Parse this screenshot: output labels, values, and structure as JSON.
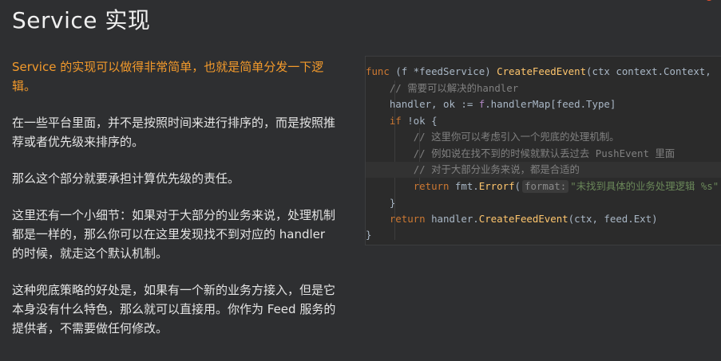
{
  "slide": {
    "title": "Service 实现",
    "logo_text": ""
  },
  "paragraphs": [
    {
      "text": "Service 的实现可以做得非常简单，也就是简单分发一下逻辑。",
      "highlight": true
    },
    {
      "text": "在一些平台里面，并不是按照时间来进行排序的，而是按照推荐或者优先级来排序的。",
      "highlight": false
    },
    {
      "text": "那么这个部分就要承担计算优先级的责任。",
      "highlight": false
    },
    {
      "text": "这里还有一个小细节：如果对于大部分的业务来说，处理机制都是一样的，那么你可以在这里发现找不到对应的 handler 的时候，就走这个默认机制。",
      "highlight": false
    },
    {
      "text": "这种兜底策略的好处是，如果有一个新的业务方接入，但是它本身没有什么特色，那么就可以直接用。你作为 Feed 服务的提供者，不需要做任何修改。",
      "highlight": false
    }
  ],
  "code": {
    "line1": {
      "kw_func": "func",
      "recv_open": " (f *",
      "recv_type": "feedService",
      "recv_close": ") ",
      "name": "CreateFeedEvent",
      "params_open": "(ctx ",
      "param_type": "context.Context",
      "params_rest": ","
    },
    "line2": {
      "comment": "// 需要可以解决的handler"
    },
    "line3": {
      "text": "handler, ok := ",
      "recv": "f",
      "rest": ".handlerMap[feed.Type]"
    },
    "line4": {
      "kw_if": "if",
      "rest": " !ok {"
    },
    "line5": {
      "comment": "// 这里你可以考虑引入一个兜底的处理机制。"
    },
    "line6": {
      "comment": "// 例如说在找不到的时候就默认丢过去 PushEvent 里面"
    },
    "line7": {
      "comment": "// 对于大部分业务来说，都是合适的"
    },
    "line8": {
      "kw_return": "return",
      "pkg": " fmt.",
      "fn": "Errorf",
      "open": "(",
      "hint": "format:",
      "str": "\"未找到具体的业务处理逻辑 %s\""
    },
    "line9": {
      "text": "}"
    },
    "line10": {
      "kw_return": "return",
      "text": " handler.",
      "fn": "CreateFeedEvent",
      "args": "(ctx, feed.Ext)"
    },
    "line11": {
      "text": "}"
    }
  },
  "colors": {
    "background": "#2e2f31",
    "accent_orange": "#f39a2b",
    "code_bg": "#2b2b2b",
    "keyword": "#cc7832",
    "function": "#ffc66d",
    "comment": "#808080",
    "string": "#6a8759"
  }
}
